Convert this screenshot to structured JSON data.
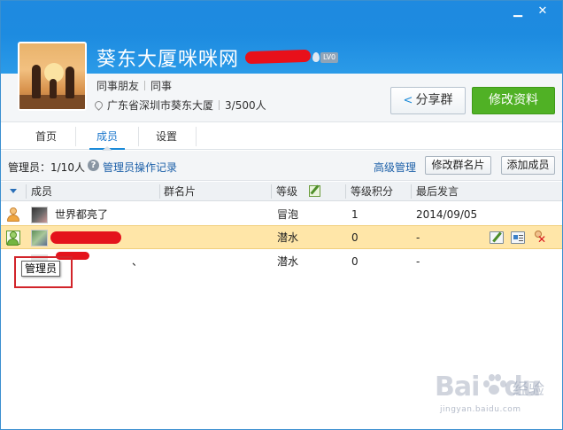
{
  "window": {
    "controls": {
      "minimize": "▁",
      "close": "✕"
    }
  },
  "group": {
    "name": "葵东大厦咪咪网",
    "level_badge": "LV0",
    "tags": [
      "同事朋友",
      "同事"
    ],
    "location": "广东省深圳市葵东大厦",
    "member_count": "3/500人"
  },
  "actions": {
    "share": "分享群",
    "edit_profile": "修改资料"
  },
  "tabs": [
    "首页",
    "成员",
    "设置"
  ],
  "active_tab": "成员",
  "toolbar": {
    "admin_count": "管理员：1/10人",
    "help": "?",
    "admin_log": "管理员操作记录",
    "advanced": "高级管理",
    "edit_card": "修改群名片",
    "add_member": "添加成员"
  },
  "table": {
    "headers": [
      "成员",
      "群名片",
      "等级",
      "等级积分",
      "最后发言"
    ],
    "rows": [
      {
        "role": "owner",
        "nickname": "世界都亮了",
        "card": "",
        "level": "冒泡",
        "points": "1",
        "last_speak": "2014/09/05"
      },
      {
        "role": "admin",
        "nickname": "",
        "card": "",
        "level": "潜水",
        "points": "0",
        "last_speak": "-",
        "selected": true
      },
      {
        "role": "member",
        "nickname": "、",
        "card": "",
        "level": "潜水",
        "points": "0",
        "last_speak": "-"
      }
    ]
  },
  "tooltip": "管理员",
  "watermark": {
    "brand": "Bai",
    "brand2": "du",
    "cn": "经验",
    "url": "jingyan.baidu.com"
  },
  "colors": {
    "header_blue": "#1f8ae0",
    "primary_green": "#50b125",
    "selected_row": "#ffe6a8",
    "redaction": "#e4131c",
    "link": "#1b5fa8"
  }
}
